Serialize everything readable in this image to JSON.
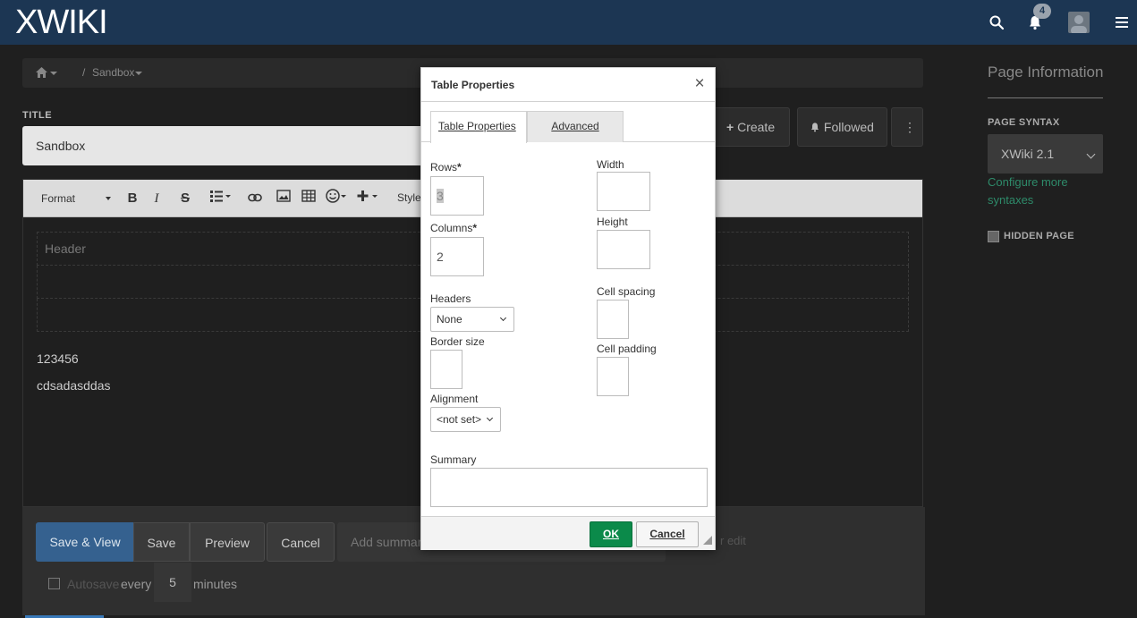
{
  "navbar": {
    "logo": "XWIKI",
    "notification_count": "4"
  },
  "breadcrumb": {
    "page": "Sandbox"
  },
  "title": {
    "label": "TITLE",
    "value": "Sandbox"
  },
  "actions": {
    "create": "Create",
    "followed": "Followed"
  },
  "toolbar": {
    "format": "Format",
    "styles": "Style"
  },
  "content": {
    "table_header": "Header",
    "paragraphs": [
      "123456",
      "cdsadasddas"
    ]
  },
  "bottom": {
    "save_view": "Save & View",
    "save": "Save",
    "preview": "Preview",
    "cancel": "Cancel",
    "summary_placeholder": "Add summar",
    "minor_edit": "r edit",
    "autosave": "Autosave",
    "every": "every",
    "interval": "5",
    "minutes": "minutes"
  },
  "page_info": {
    "title": "Page Information",
    "syntax_label": "PAGE SYNTAX",
    "syntax_value": "XWiki 2.1",
    "configure_link": "Configure more syntaxes",
    "hidden_label": "HIDDEN PAGE"
  },
  "dialog": {
    "title": "Table Properties",
    "tabs": [
      "Table Properties",
      "Advanced"
    ],
    "rows_label": "Rows",
    "rows_value": "3",
    "columns_label": "Columns",
    "columns_value": "2",
    "headers_label": "Headers",
    "headers_value": "None",
    "border_label": "Border size",
    "alignment_label": "Alignment",
    "alignment_value": "<not set>",
    "width_label": "Width",
    "height_label": "Height",
    "cell_spacing_label": "Cell spacing",
    "cell_padding_label": "Cell padding",
    "summary_label": "Summary",
    "required_mark": "*",
    "ok": "OK",
    "cancel": "Cancel"
  },
  "colors": {
    "navbar": "#1c3653",
    "primary": "#35618f",
    "ok_green": "#0b8a4a",
    "link_green": "#2e8b6a"
  }
}
